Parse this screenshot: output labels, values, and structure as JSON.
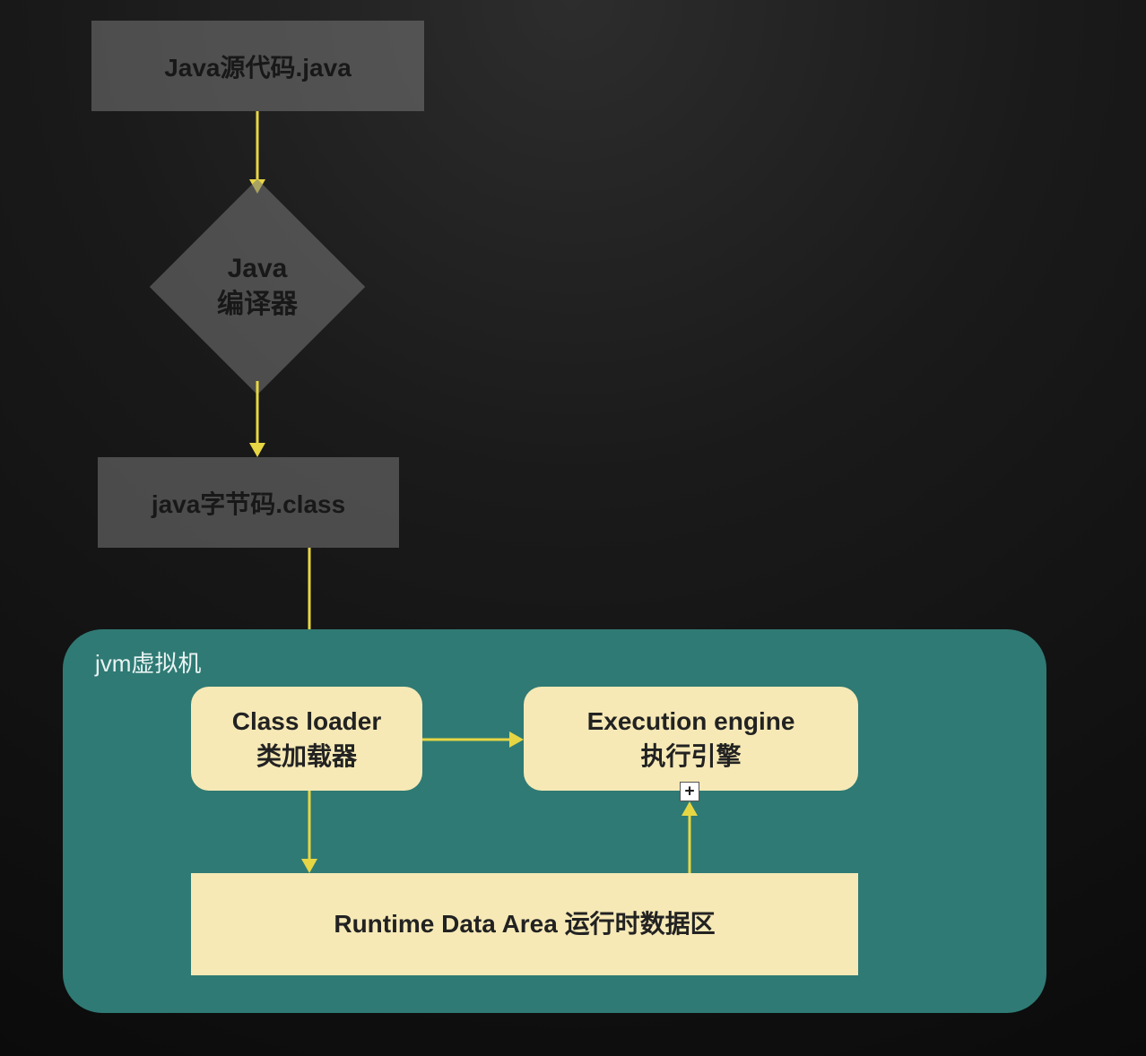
{
  "nodes": {
    "source": "Java源代码.java",
    "compiler_line1": "Java",
    "compiler_line2": "编译器",
    "bytecode": "java字节码.class",
    "jvm_title": "jvm虚拟机",
    "class_loader_line1": "Class loader",
    "class_loader_line2": "类加载器",
    "execution_engine_line1": "Execution engine",
    "execution_engine_line2": "执行引擎",
    "runtime_data_area": "Runtime Data Area 运行时数据区",
    "plus_badge": "+"
  },
  "colors": {
    "arrow": "#e7d644",
    "jvm_bg": "#2f7a74",
    "cream": "#f6e9b6",
    "gray_box": "rgba(120,120,120,0.55)"
  }
}
